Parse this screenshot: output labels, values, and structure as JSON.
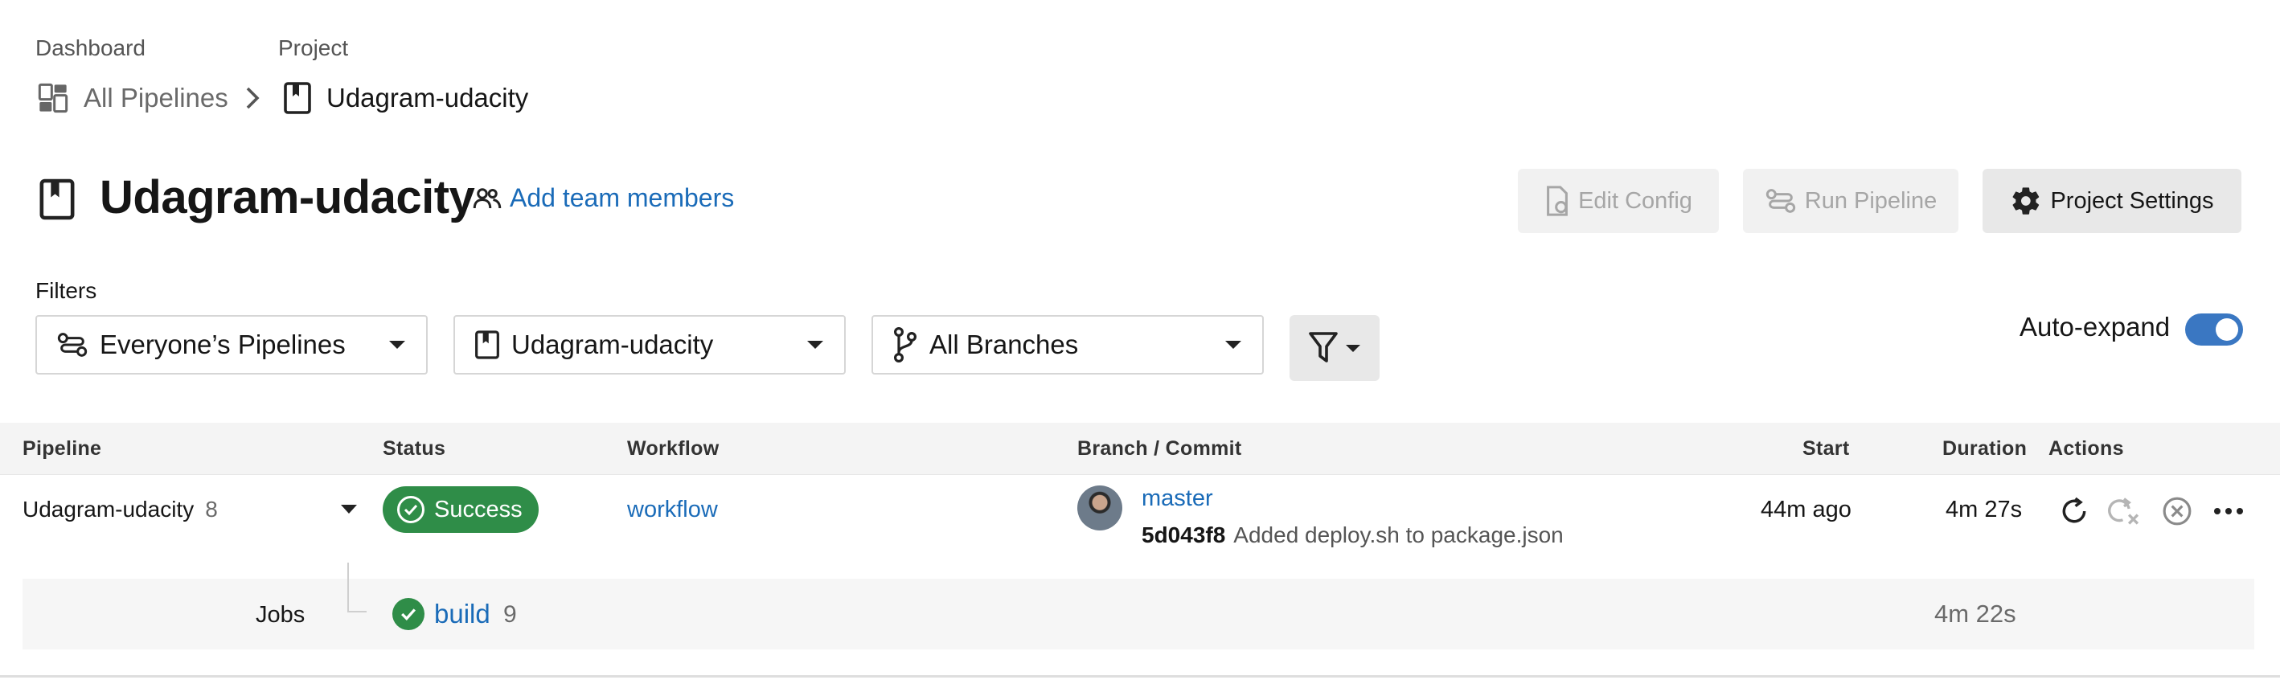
{
  "breadcrumb": {
    "dashboard_label": "Dashboard",
    "dashboard_item": "All Pipelines",
    "project_label": "Project",
    "project_item": "Udagram-udacity"
  },
  "header": {
    "title": "Udagram-udacity",
    "add_team": "Add team members",
    "edit_config": "Edit Config",
    "run_pipeline": "Run Pipeline",
    "project_settings": "Project Settings"
  },
  "filters": {
    "label": "Filters",
    "pipelines": "Everyone’s Pipelines",
    "project": "Udagram-udacity",
    "branches": "All Branches",
    "auto_expand": "Auto-expand",
    "auto_expand_on": true
  },
  "table": {
    "headers": [
      "Pipeline",
      "Status",
      "Workflow",
      "Branch / Commit",
      "Start",
      "Duration",
      "Actions"
    ],
    "row": {
      "pipeline": "Udagram-udacity",
      "number": "8",
      "status": "Success",
      "workflow": "workflow",
      "branch": "master",
      "sha": "5d043f8",
      "message": "Added deploy.sh to package.json",
      "start": "44m ago",
      "duration": "4m 27s"
    },
    "jobs": {
      "label": "Jobs",
      "name": "build",
      "number": "9",
      "duration": "4m 22s"
    }
  },
  "colors": {
    "success": "#2f8d48",
    "link": "#1a6bb8",
    "toggle": "#3a77c2"
  }
}
